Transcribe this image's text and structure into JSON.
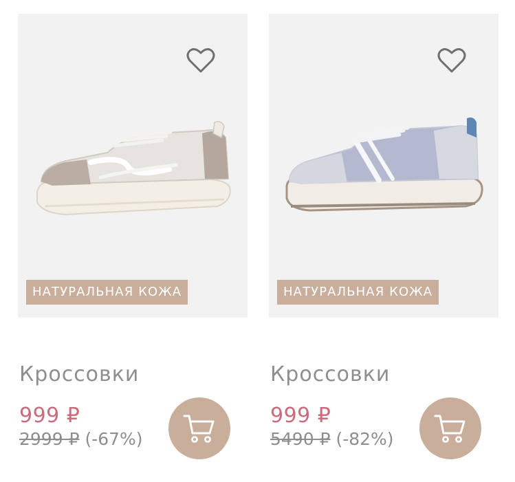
{
  "products": [
    {
      "badge": "НАТУРАЛЬНАЯ КОЖА",
      "title": "Кроссовки",
      "price": "999 ₽",
      "old_price": "2999 ₽",
      "discount": "(-67%)",
      "image_icon": "sneaker-beige-image",
      "favorite_icon": "heart-outline-icon",
      "cart_icon": "cart-icon"
    },
    {
      "badge": "НАТУРАЛЬНАЯ КОЖА",
      "title": "Кроссовки",
      "price": "999 ₽",
      "old_price": "5490 ₽",
      "discount": "(-82%)",
      "image_icon": "sneaker-blue-image",
      "favorite_icon": "heart-outline-icon",
      "cart_icon": "cart-icon"
    }
  ],
  "colors": {
    "image_bg": "#f2f2f2",
    "badge_bg": "#c9ae9b",
    "price": "#cc6b7c",
    "muted_text": "#8e8e8e",
    "cart_button": "#c9ae9b"
  }
}
